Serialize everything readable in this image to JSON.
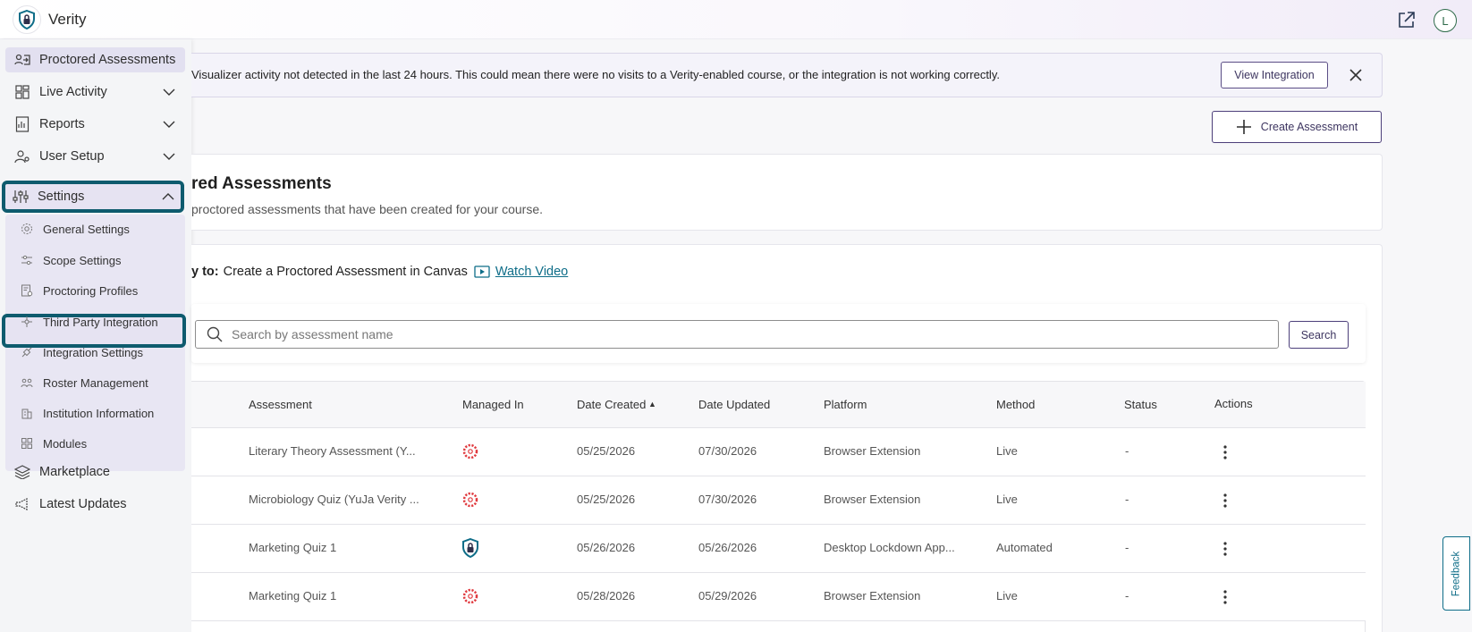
{
  "app": {
    "brand": "Verity",
    "user_initial": "L"
  },
  "sidebar": {
    "items": [
      {
        "label": "Proctored Assessments"
      },
      {
        "label": "Live Activity"
      },
      {
        "label": "Reports"
      },
      {
        "label": "User Setup"
      },
      {
        "label": "Settings"
      },
      {
        "label": "Marketplace"
      },
      {
        "label": "Latest Updates"
      }
    ],
    "settings_sub": [
      {
        "label": "General Settings"
      },
      {
        "label": "Scope Settings"
      },
      {
        "label": "Proctoring Profiles"
      },
      {
        "label": "Third Party Integration"
      },
      {
        "label": "Integration Settings"
      },
      {
        "label": "Roster Management"
      },
      {
        "label": "Institution Information"
      },
      {
        "label": "Modules"
      }
    ]
  },
  "banner": {
    "text": "Visualizer activity not detected in the last 24 hours. This could mean there were no visits to a Verity-enabled course, or the integration is not working correctly.",
    "button": "View Integration"
  },
  "toolbar": {
    "create_label": "Create Assessment"
  },
  "page": {
    "title": "red Assessments",
    "subtitle": "proctored assessments that have been created for your course."
  },
  "howto": {
    "prefix": "y to:",
    "text": "Create a Proctored Assessment in Canvas",
    "link": "Watch Video"
  },
  "search": {
    "placeholder": "Search by assessment name",
    "button": "Search"
  },
  "table": {
    "headers": {
      "assessment": "Assessment",
      "managed": "Managed In",
      "created": "Date Created",
      "sort_indicator": "▲",
      "updated": "Date Updated",
      "platform": "Platform",
      "method": "Method",
      "status": "Status",
      "actions": "Actions"
    },
    "rows": [
      {
        "assessment": "Literary Theory Assessment (Y...",
        "managed_icon": "canvas-icon",
        "created": "05/25/2026",
        "updated": "07/30/2026",
        "platform": "Browser Extension",
        "method": "Live",
        "status": "-"
      },
      {
        "assessment": "Microbiology Quiz (YuJa Verity ...",
        "managed_icon": "canvas-icon",
        "created": "05/25/2026",
        "updated": "07/30/2026",
        "platform": "Browser Extension",
        "method": "Live",
        "status": "-"
      },
      {
        "assessment": "Marketing Quiz 1",
        "managed_icon": "verity-shield-icon",
        "created": "05/26/2026",
        "updated": "05/26/2026",
        "platform": "Desktop Lockdown App...",
        "method": "Automated",
        "status": "-"
      },
      {
        "assessment": "Marketing Quiz 1",
        "managed_icon": "canvas-icon",
        "created": "05/28/2026",
        "updated": "05/29/2026",
        "platform": "Browser Extension",
        "method": "Live",
        "status": "-"
      }
    ]
  },
  "feedback": {
    "label": "Feedback"
  },
  "colors": {
    "accent": "#0e5b6e",
    "brand_purple": "#4c3f7a",
    "canvas_red": "#e0393e",
    "link": "#0e6d88"
  }
}
